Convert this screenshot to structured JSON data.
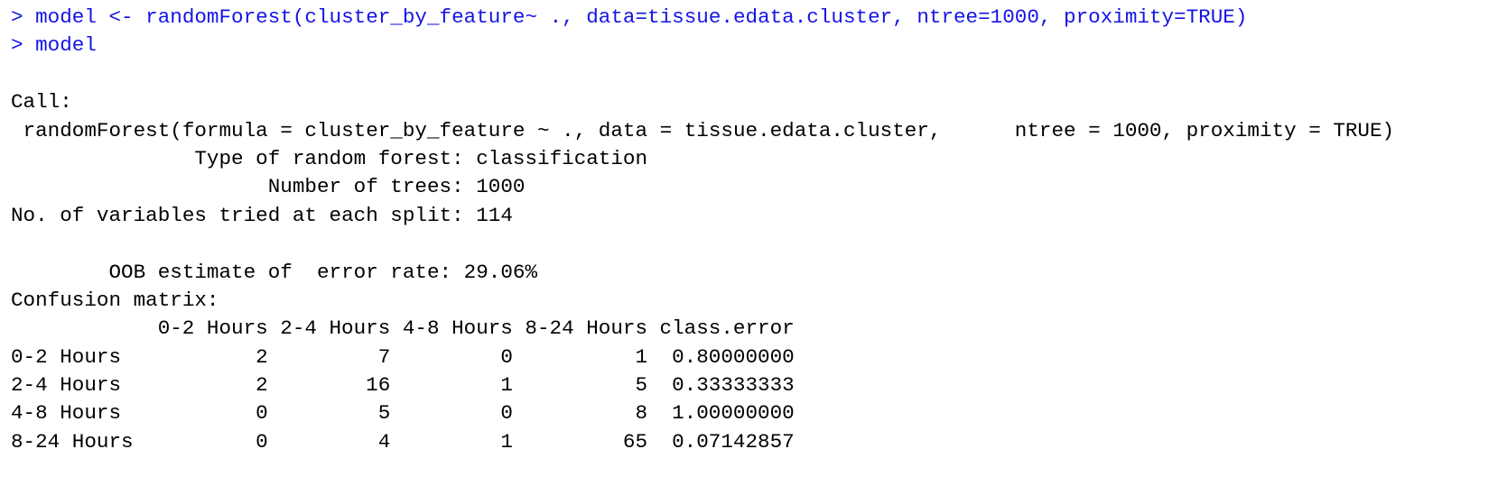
{
  "colors": {
    "input": "#1414e6",
    "output": "#000000",
    "background": "#ffffff"
  },
  "commands": [
    "> model <- randomForest(cluster_by_feature~ ., data=tissue.edata.cluster, ntree=1000, proximity=TRUE)",
    "> model"
  ],
  "output": {
    "call_label": "Call:",
    "call": " randomForest(formula = cluster_by_feature ~ ., data = tissue.edata.cluster,      ntree = 1000, proximity = TRUE)",
    "type_line": "               Type of random forest: classification",
    "trees_line": "                     Number of trees: 1000",
    "mtry_line": "No. of variables tried at each split: 114",
    "oob_line": "        OOB estimate of  error rate: 29.06%",
    "confusion_label": "Confusion matrix:"
  },
  "confusion_matrix": {
    "headers": [
      "0-2 Hours",
      "2-4 Hours",
      "4-8 Hours",
      "8-24 Hours",
      "class.error"
    ],
    "rows": [
      {
        "label": "0-2 Hours",
        "values": [
          "2",
          "7",
          "0",
          "1",
          "0.80000000"
        ]
      },
      {
        "label": "2-4 Hours",
        "values": [
          "2",
          "16",
          "1",
          "5",
          "0.33333333"
        ]
      },
      {
        "label": "4-8 Hours",
        "values": [
          "0",
          "5",
          "0",
          "8",
          "1.00000000"
        ]
      },
      {
        "label": "8-24 Hours",
        "values": [
          "0",
          "4",
          "1",
          "65",
          "0.07142857"
        ]
      }
    ]
  }
}
